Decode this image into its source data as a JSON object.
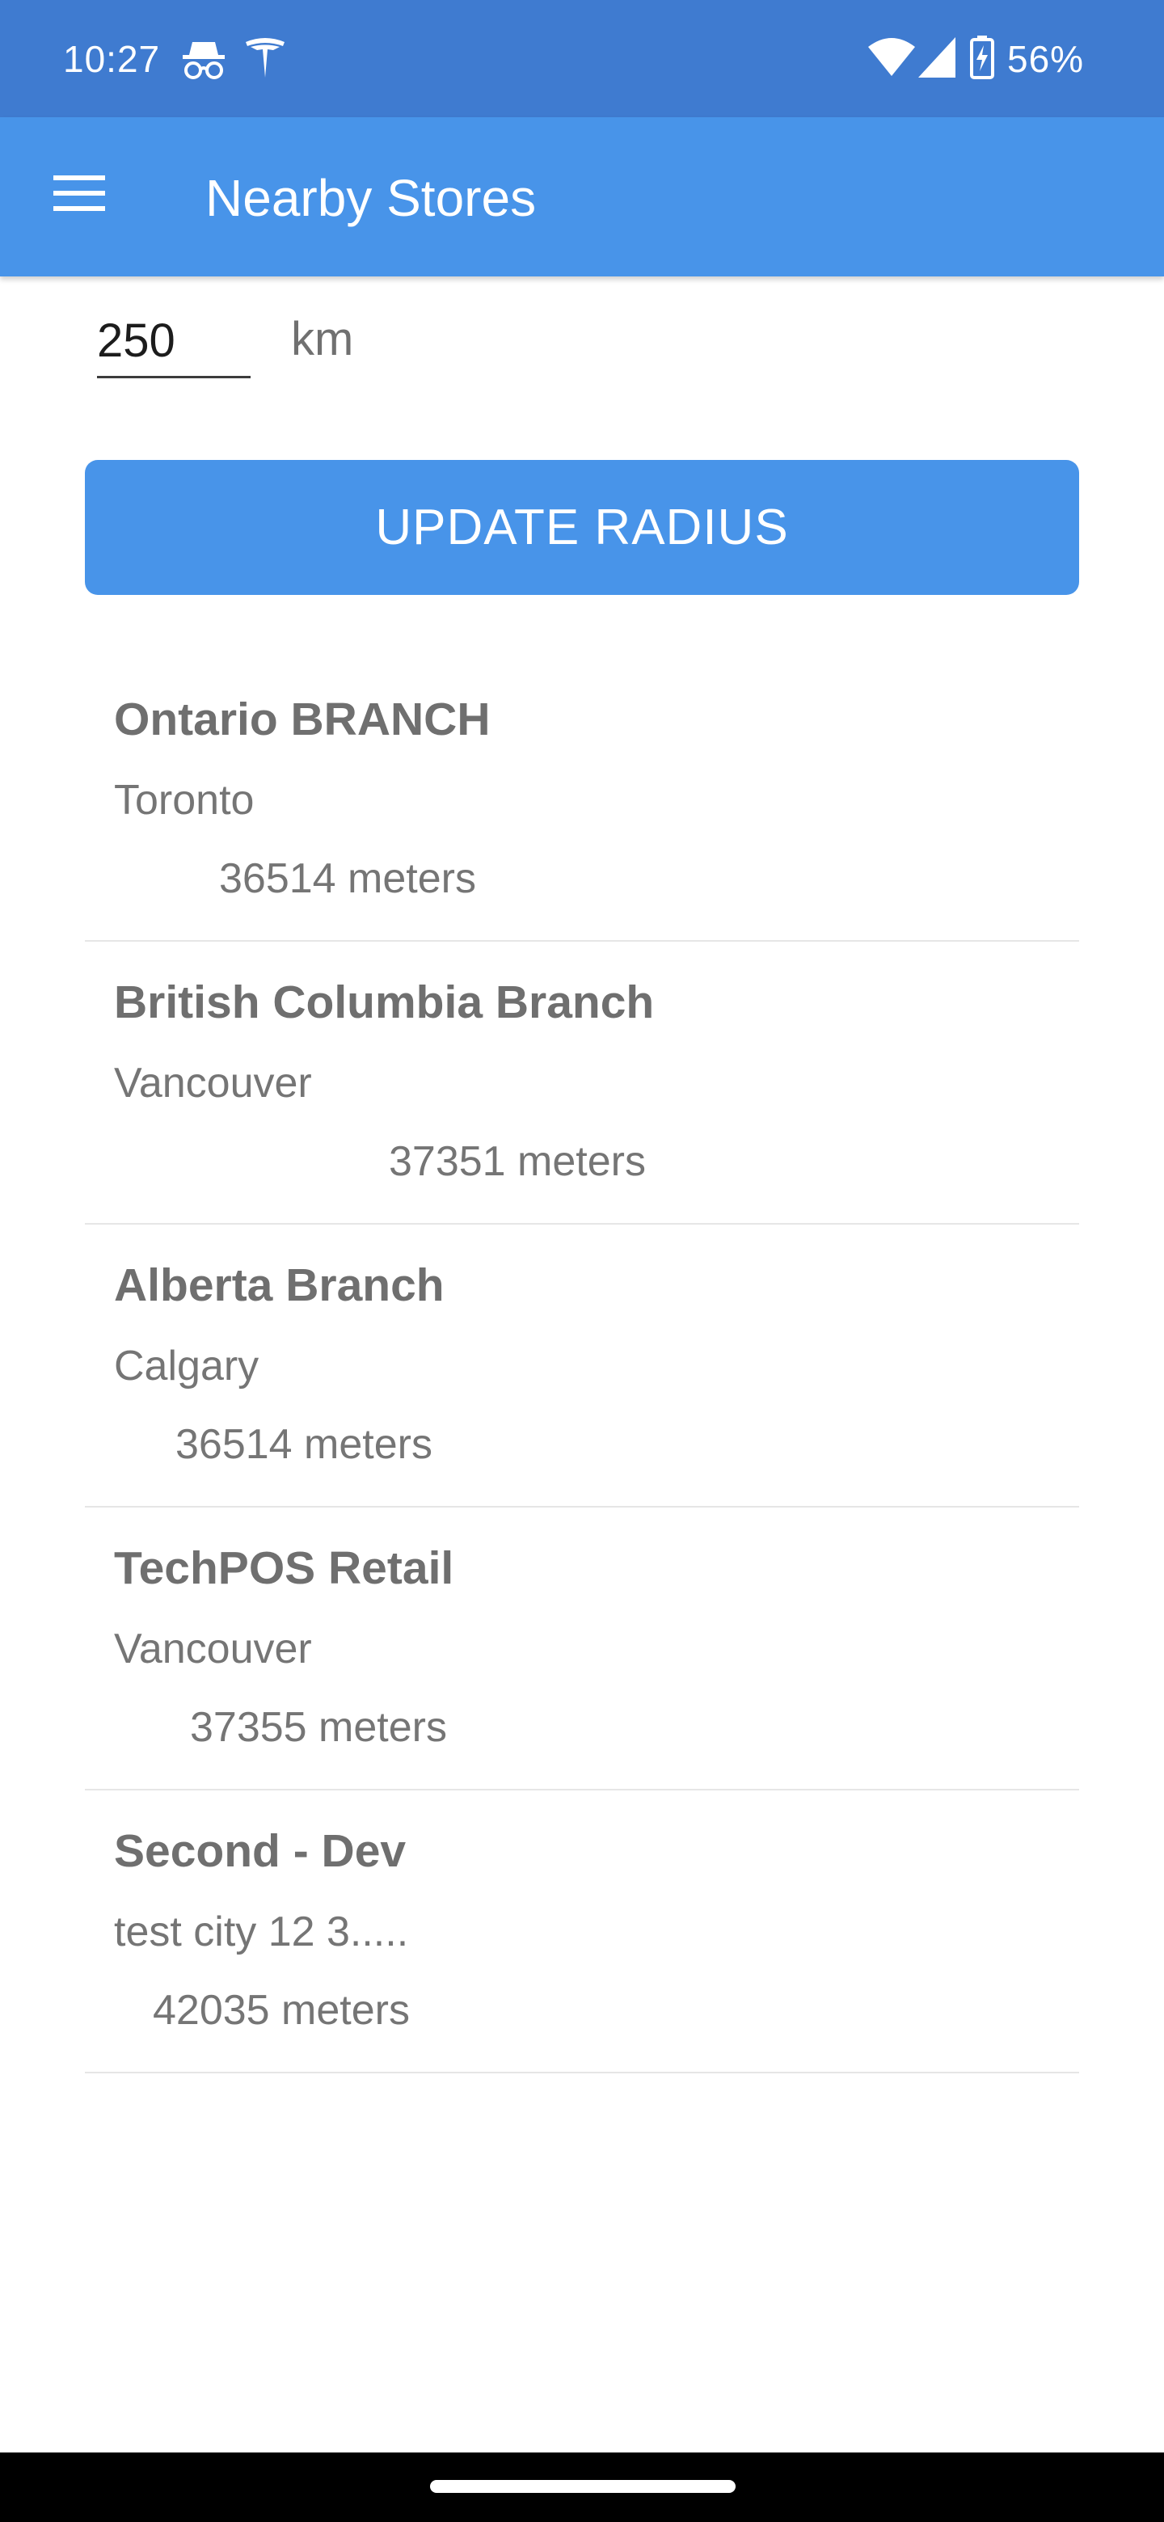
{
  "status_bar": {
    "time": "10:27",
    "battery": "56%",
    "icons": [
      "incognito-icon",
      "tesla-icon",
      "wifi-icon",
      "cell-signal-icon",
      "battery-charging-icon"
    ]
  },
  "app_bar": {
    "title": "Nearby Stores",
    "menu_icon": "hamburger-menu-icon",
    "color": "#4894e9"
  },
  "radius": {
    "value": "250",
    "unit": "km"
  },
  "update_button": {
    "label": "UPDATE RADIUS",
    "color": "#4894e9"
  },
  "stores": [
    {
      "name": "Ontario BRANCH",
      "city": "Toronto",
      "distance": "36514 meters"
    },
    {
      "name": "British Columbia Branch",
      "city": "Vancouver",
      "distance": "37351 meters"
    },
    {
      "name": "Alberta Branch",
      "city": "Calgary",
      "distance": "36514 meters"
    },
    {
      "name": "TechPOS Retail",
      "city": "Vancouver",
      "distance": "37355 meters"
    },
    {
      "name": "Second - Dev",
      "city": "test city 12 3.....",
      "distance": "42035 meters"
    }
  ]
}
